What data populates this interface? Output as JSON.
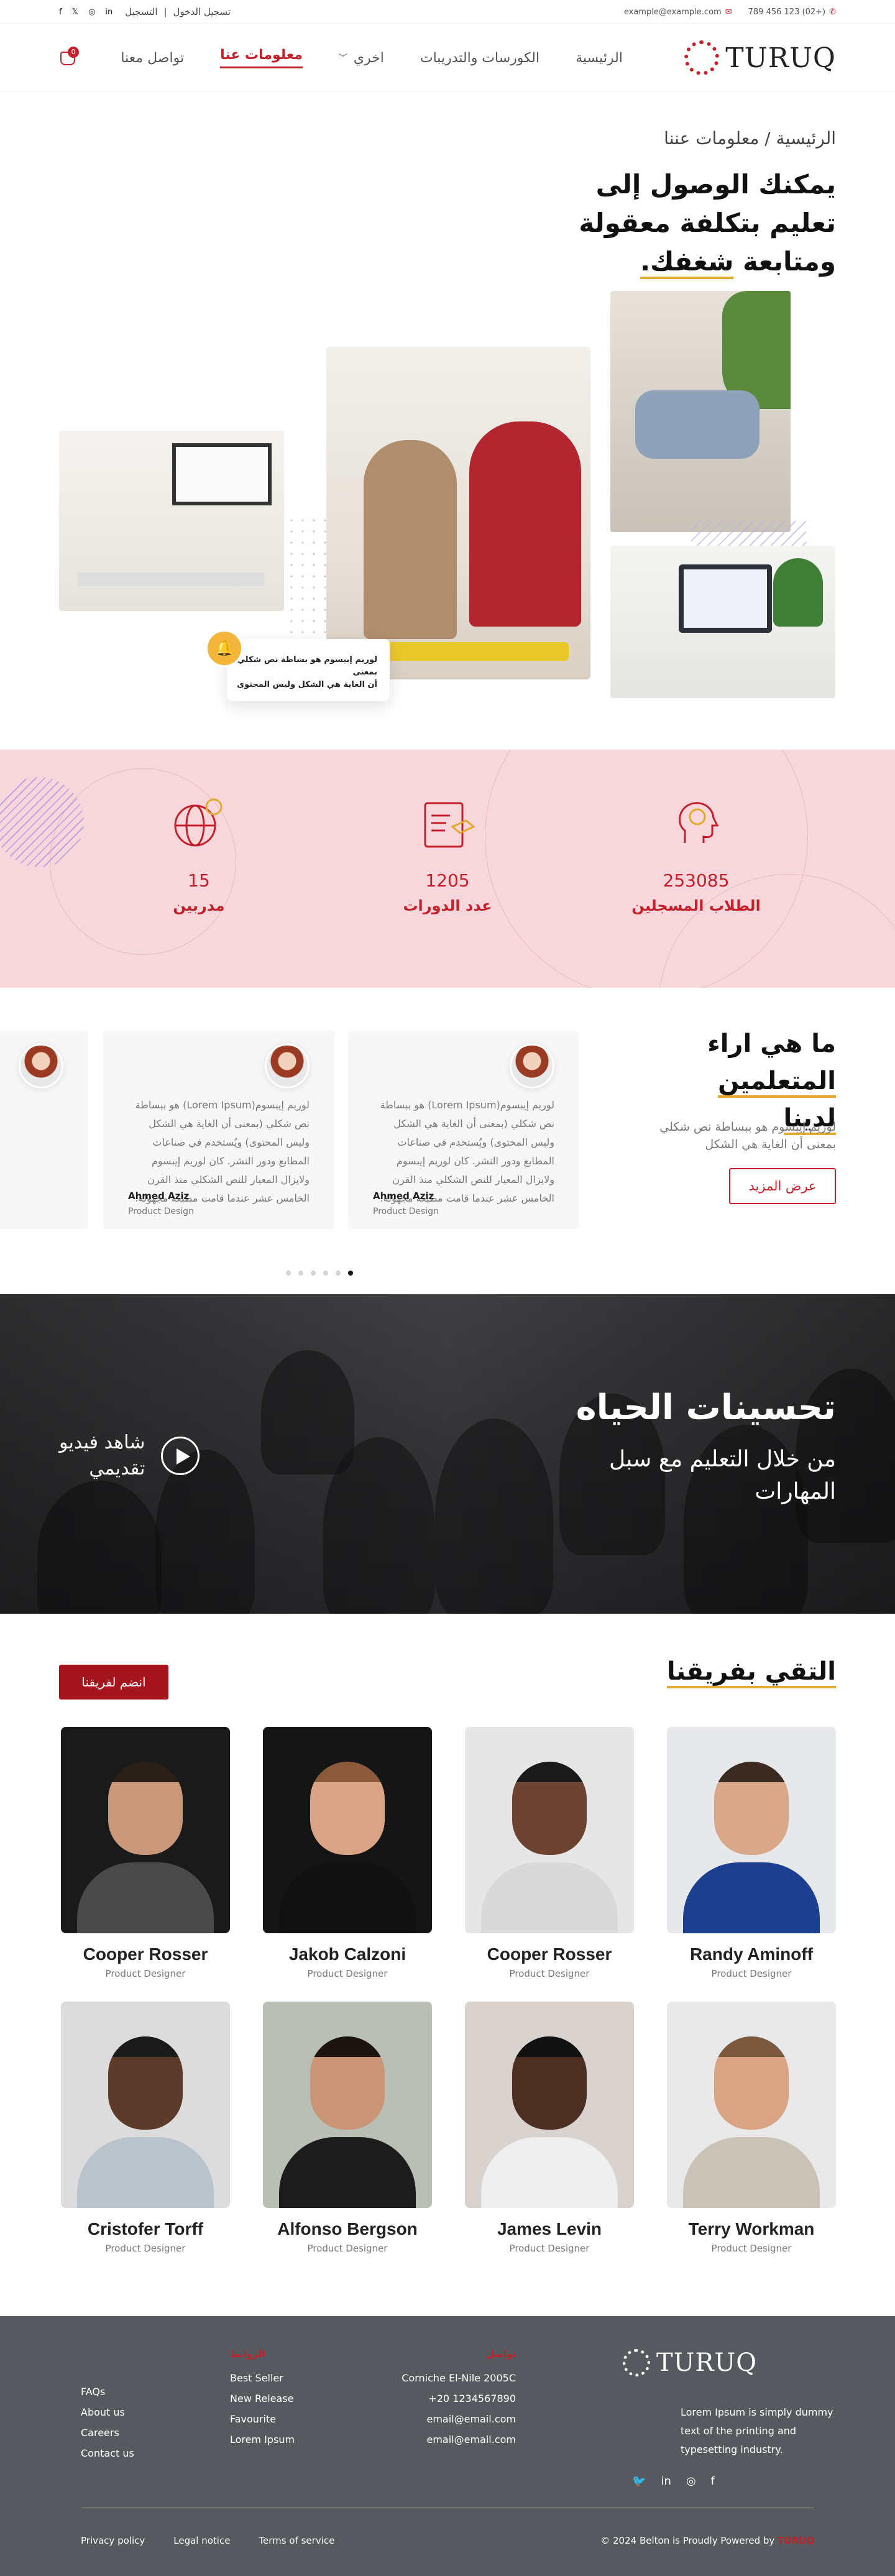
{
  "topbar": {
    "phone": "(+02) 123 456 789",
    "email": "example@example.com",
    "login": "تسجيل الدخول",
    "signup": "التسجيل",
    "social_icons": [
      "facebook-icon",
      "twitter-icon",
      "instagram-icon",
      "linkedin-icon"
    ]
  },
  "header": {
    "logo_text": "TURUQ",
    "nav": [
      "الرئيسية",
      "الكورسات والتدريبات",
      "اخري",
      "معلومات عنا",
      "تواصل معنا"
    ],
    "active_nav": "معلومات عنا",
    "cart_count": "0"
  },
  "hero": {
    "breadcrumb": "الرئيسية / معلومات عننا",
    "title_line1": "يمكنك الوصول إلى",
    "title_line2": "تعليم بتكلفة معقولة",
    "title_line3_plain": "ومتابعة",
    "title_line3_underlined": "شغفك.",
    "note_line1": "لوريم إيبسوم هو بساطة نص شكلي بمعنى",
    "note_line2": "أن الغاية هي الشكل وليس المحتوى"
  },
  "stats": [
    {
      "number": "253085",
      "label": "الطلاب المسجلين",
      "icon": "head-brain-icon"
    },
    {
      "number": "1205",
      "label": "عدد الدورات",
      "icon": "certificate-icon"
    },
    {
      "number": "15",
      "label": "مدربين",
      "icon": "globe-award-icon"
    }
  ],
  "testimonials": {
    "title_line1": "ما هي اراء",
    "title_line2": "المتعلمين لدينا",
    "desc": "لوريم إيبسوم هو ببساطة نص شكلي بمعنى أن الغاية هي الشكل",
    "button": "عرض المزيد",
    "cards": [
      {
        "text": "لوريم إيبسوم(Lorem Ipsum) هو ببساطة نص شكلي (بمعنى أن الغاية هي الشكل وليس المحتوى) ويُستخدم في صناعات المطابع ودور النشر. كان لوريم إيبسوم ولايزال المعيار للنص الشكلي منذ القرن الخامس عشر عندما قامت مطبعة مجهولة.",
        "name": "Ahmed Aziz",
        "role": "Product Design"
      },
      {
        "text": "لوريم إيبسوم(Lorem Ipsum) هو ببساطة نص شكلي (بمعنى أن الغاية هي الشكل وليس المحتوى) ويُستخدم في صناعات المطابع ودور النشر. كان لوريم إيبسوم ولايزال المعيار للنص الشكلي منذ القرن الخامس عشر عندما قامت مطبعة مجهولة.",
        "name": "Ahmed Aziz",
        "role": "Product Design"
      }
    ],
    "pages": 6,
    "active_page": 6
  },
  "video": {
    "title": "تحسينات الحياه",
    "subtitle": "من خلال التعليم مع سبل المهارات",
    "play_label_line1": "شاهد فيديو",
    "play_label_line2": "تقديمي"
  },
  "team": {
    "title": "التقي بفريقنا",
    "join_button": "انضم لفريقنا",
    "members": [
      {
        "name": "Randy Aminoff",
        "role": "Product Designer",
        "bg": "#e7e8ec",
        "skin": "#d9a88a",
        "shirt": "#1d3f8f",
        "hair": "#3a2a20"
      },
      {
        "name": "Cooper Rosser",
        "role": "Product Designer",
        "bg": "#e6e6e6",
        "skin": "#6b4330",
        "shirt": "#d9d9d9",
        "hair": "#1a1a1a"
      },
      {
        "name": "Jakob Calzoni",
        "role": "Product Designer",
        "bg": "#151515",
        "skin": "#d9a386",
        "shirt": "#111",
        "hair": "#8b5a3a"
      },
      {
        "name": "Cooper Rosser",
        "role": "Product Designer",
        "bg": "#1a1a1a",
        "skin": "#c9977a",
        "shirt": "#4a4a4a",
        "hair": "#2a2018"
      },
      {
        "name": "Terry Workman",
        "role": "Product Designer",
        "bg": "#e9e9e9",
        "skin": "#d8a484",
        "shirt": "#c9c2b6",
        "hair": "#7b5a40"
      },
      {
        "name": "James Levin",
        "role": "Product Designer",
        "bg": "#d9d3cf",
        "skin": "#4b2f22",
        "shirt": "#efefef",
        "hair": "#111"
      },
      {
        "name": "Alfonso Bergson",
        "role": "Product Designer",
        "bg": "#b9bfb5",
        "skin": "#c99576",
        "shirt": "#1c1c1c",
        "hair": "#1c140e"
      },
      {
        "name": "Cristofer Torff",
        "role": "Product Designer",
        "bg": "#dcdcdc",
        "skin": "#5d3b2b",
        "shirt": "#b9c3cb",
        "hair": "#1a1a1a"
      }
    ]
  },
  "footer": {
    "logo_text": "TURUQ",
    "about": "Lorem Ipsum is simply dummy text of the printing and typesetting industry.",
    "contact_heading": "تواصل",
    "contact": [
      "Corniche El-Nile 2005C",
      "+20 1234567890",
      "email@email.com",
      "email@email.com"
    ],
    "links_heading": "الروابط",
    "links": [
      "Best Seller",
      "New Release",
      "Favourite",
      "Lorem Ipsum"
    ],
    "pages": [
      "FAQs",
      "About us",
      "Careers",
      "Contact us"
    ],
    "legal": [
      "Privacy policy",
      "Legal notice",
      "Terms of service"
    ],
    "copyright": "© 2024 Belton is Proudly Powered by",
    "copyright_brand": "TURUQ"
  },
  "colors": {
    "primary": "#c51f2a",
    "accent": "#e3a92b",
    "stats_bg": "#f7d7dc",
    "footer_bg": "#565a5f"
  }
}
